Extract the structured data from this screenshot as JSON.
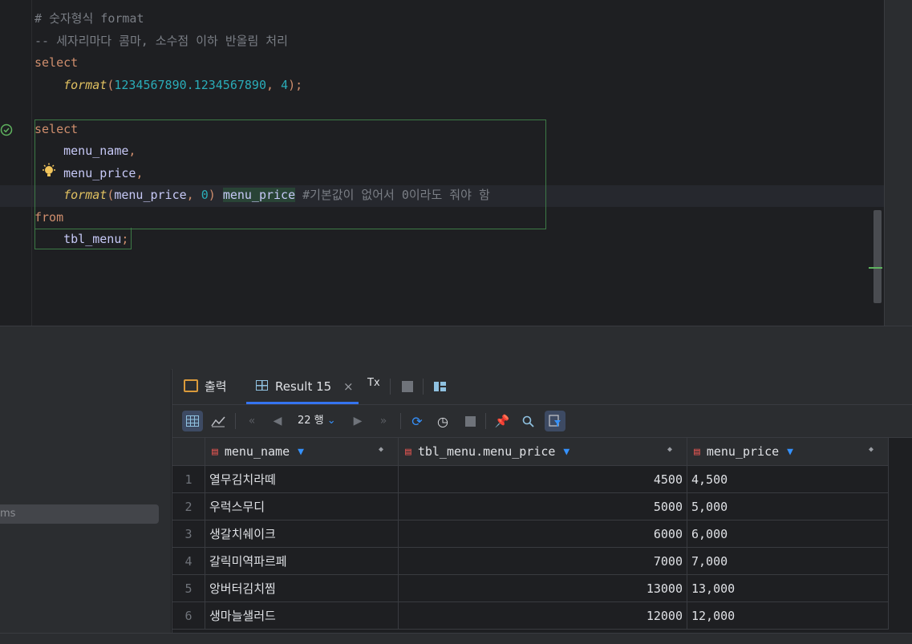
{
  "editor": {
    "lines": [
      {
        "parts": [
          {
            "t": "# ",
            "c": "cmt"
          },
          {
            "t": "숫자형식",
            "c": "cmt"
          },
          {
            "t": " format",
            "c": "cmt"
          }
        ]
      },
      {
        "parts": [
          {
            "t": "-- ",
            "c": "cmt"
          },
          {
            "t": "세자리마다",
            "c": "cmt"
          },
          {
            "t": " 콤마, 소수점 이하 반올림 처리",
            "c": "cmt"
          }
        ]
      },
      {
        "parts": [
          {
            "t": "select",
            "c": "kw"
          }
        ]
      },
      {
        "parts": [
          {
            "t": "    "
          },
          {
            "t": "format",
            "c": "fn"
          },
          {
            "t": "(",
            "c": "kw"
          },
          {
            "t": "1234567890.1234567890",
            "c": "num"
          },
          {
            "t": ", ",
            "c": "kw"
          },
          {
            "t": "4",
            "c": "num"
          },
          {
            "t": ");",
            "c": "kw"
          }
        ]
      },
      {
        "parts": []
      },
      {
        "parts": [
          {
            "t": "select",
            "c": "kw"
          }
        ]
      },
      {
        "parts": [
          {
            "t": "    "
          },
          {
            "t": "menu_name",
            "c": "ident"
          },
          {
            "t": ",",
            "c": "kw"
          }
        ]
      },
      {
        "parts": [
          {
            "t": "    "
          },
          {
            "t": "menu_price",
            "c": "ident"
          },
          {
            "t": ",",
            "c": "kw"
          }
        ]
      },
      {
        "parts": [
          {
            "t": "    "
          },
          {
            "t": "format",
            "c": "fn"
          },
          {
            "t": "(",
            "c": "kw"
          },
          {
            "t": "menu_price",
            "c": "ident"
          },
          {
            "t": ", ",
            "c": "kw"
          },
          {
            "t": "0",
            "c": "num"
          },
          {
            "t": ") ",
            "c": "kw"
          },
          {
            "t": "menu_price",
            "c": "alias"
          },
          {
            "t": " #기본값이 없어서 0이라도 줘야 함",
            "c": "cmt"
          }
        ]
      },
      {
        "parts": [
          {
            "t": "from",
            "c": "kw"
          }
        ]
      },
      {
        "parts": [
          {
            "t": "    "
          },
          {
            "t": "tbl_menu",
            "c": "ident"
          },
          {
            "t": ";",
            "c": "kw"
          }
        ]
      }
    ]
  },
  "left_panel": {
    "item_label": "ms"
  },
  "tabs": {
    "output_label": "출력",
    "result_label": "Result 15",
    "close_glyph": "×",
    "tx_label": "Tx"
  },
  "toolbar": {
    "rows_label": "22 행"
  },
  "grid": {
    "columns": [
      "menu_name",
      "tbl_menu.menu_price",
      "menu_price"
    ],
    "rows": [
      {
        "n": "1",
        "name": "열무김치라떼",
        "price": "4500",
        "fmt": "4,500"
      },
      {
        "n": "2",
        "name": "우럭스무디",
        "price": "5000",
        "fmt": "5,000"
      },
      {
        "n": "3",
        "name": "생갈치쉐이크",
        "price": "6000",
        "fmt": "6,000"
      },
      {
        "n": "4",
        "name": "갈릭미역파르페",
        "price": "7000",
        "fmt": "7,000"
      },
      {
        "n": "5",
        "name": "앙버터김치찜",
        "price": "13000",
        "fmt": "13,000"
      },
      {
        "n": "6",
        "name": "생마늘샐러드",
        "price": "12000",
        "fmt": "12,000"
      }
    ]
  },
  "colors": {
    "accent": "#3574f0",
    "keyword": "#cf8e6d",
    "number": "#2aacb8",
    "function": "#e0c060"
  }
}
